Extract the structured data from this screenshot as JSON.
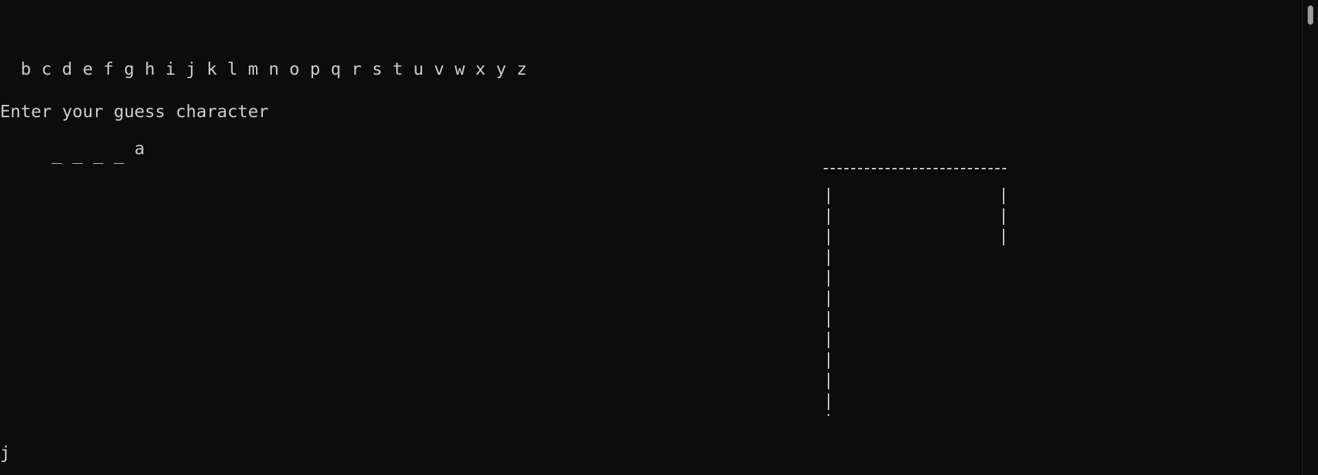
{
  "terminal": {
    "alphabet_line": "  b c d e f g h i j k l m n o p q r s t u v w x y z",
    "prompt": "Enter your guess character",
    "word_blanks": " _ _ _ _ ",
    "guessed_letter": "a",
    "input_text": "j"
  },
  "colors": {
    "background": "#0c0c0c",
    "text": "#cccccc"
  },
  "icons": {
    "gallows": "ascii-gallows"
  }
}
